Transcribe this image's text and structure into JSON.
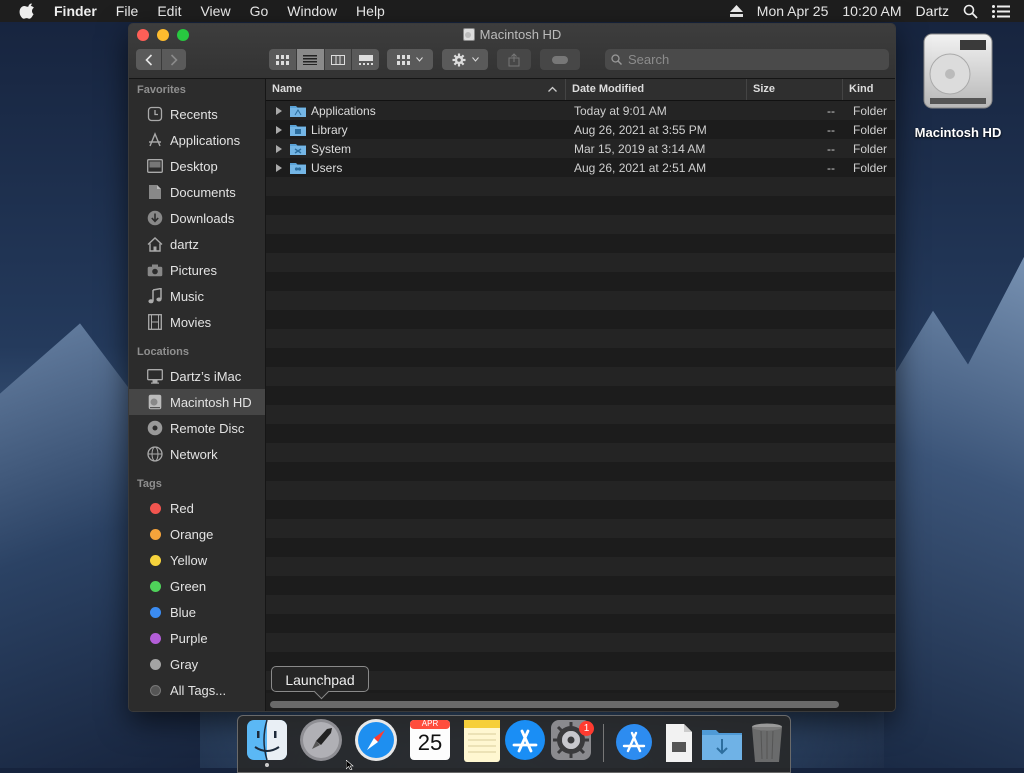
{
  "menubar": {
    "items": [
      "Finder",
      "File",
      "Edit",
      "View",
      "Go",
      "Window",
      "Help"
    ],
    "date": "Mon Apr 25",
    "time": "10:20 AM",
    "user": "Dartz"
  },
  "desktop": {
    "drive_label": "Macintosh HD"
  },
  "window": {
    "title": "Macintosh HD",
    "search_placeholder": "Search",
    "active_view": "list"
  },
  "sidebar": {
    "favorites_header": "Favorites",
    "favorites": [
      {
        "label": "Recents",
        "icon": "clock-icon"
      },
      {
        "label": "Applications",
        "icon": "applications-icon"
      },
      {
        "label": "Desktop",
        "icon": "desktop-icon"
      },
      {
        "label": "Documents",
        "icon": "document-icon"
      },
      {
        "label": "Downloads",
        "icon": "download-icon"
      },
      {
        "label": "dartz",
        "icon": "home-icon"
      },
      {
        "label": "Pictures",
        "icon": "camera-icon"
      },
      {
        "label": "Music",
        "icon": "music-icon"
      },
      {
        "label": "Movies",
        "icon": "film-icon"
      }
    ],
    "locations_header": "Locations",
    "locations": [
      {
        "label": "Dartz’s iMac",
        "icon": "imac-icon"
      },
      {
        "label": "Macintosh HD",
        "icon": "hard-drive-icon",
        "selected": true
      },
      {
        "label": "Remote Disc",
        "icon": "disc-icon"
      },
      {
        "label": "Network",
        "icon": "network-icon"
      }
    ],
    "tags_header": "Tags",
    "tags": [
      {
        "label": "Red",
        "color": "#f2554f"
      },
      {
        "label": "Orange",
        "color": "#f5a33b"
      },
      {
        "label": "Yellow",
        "color": "#f6d33c"
      },
      {
        "label": "Green",
        "color": "#4fd25a"
      },
      {
        "label": "Blue",
        "color": "#3b8cf2"
      },
      {
        "label": "Purple",
        "color": "#b35ed8"
      },
      {
        "label": "Gray",
        "color": "#a3a3a3"
      },
      {
        "label": "All Tags...",
        "color": "#555555"
      }
    ]
  },
  "columns": {
    "name": "Name",
    "date": "Date Modified",
    "size": "Size",
    "kind": "Kind"
  },
  "files": [
    {
      "name": "Applications",
      "date": "Today at 9:01 AM",
      "size": "--",
      "kind": "Folder"
    },
    {
      "name": "Library",
      "date": "Aug 26, 2021 at 3:55 PM",
      "size": "--",
      "kind": "Folder"
    },
    {
      "name": "System",
      "date": "Mar 15, 2019 at 3:14 AM",
      "size": "--",
      "kind": "Folder"
    },
    {
      "name": "Users",
      "date": "Aug 26, 2021 at 2:51 AM",
      "size": "--",
      "kind": "Folder"
    }
  ],
  "tooltip": "Launchpad",
  "dock": {
    "items": [
      "finder-icon",
      "launchpad-icon",
      "safari-icon",
      "calendar-icon",
      "notes-icon",
      "app-store-icon",
      "system-preferences-icon",
      "applications-folder-icon",
      "document-stack-icon",
      "downloads-folder-icon",
      "trash-icon"
    ],
    "calendar_month": "APR",
    "calendar_day": "25",
    "prefs_badge": "1"
  }
}
